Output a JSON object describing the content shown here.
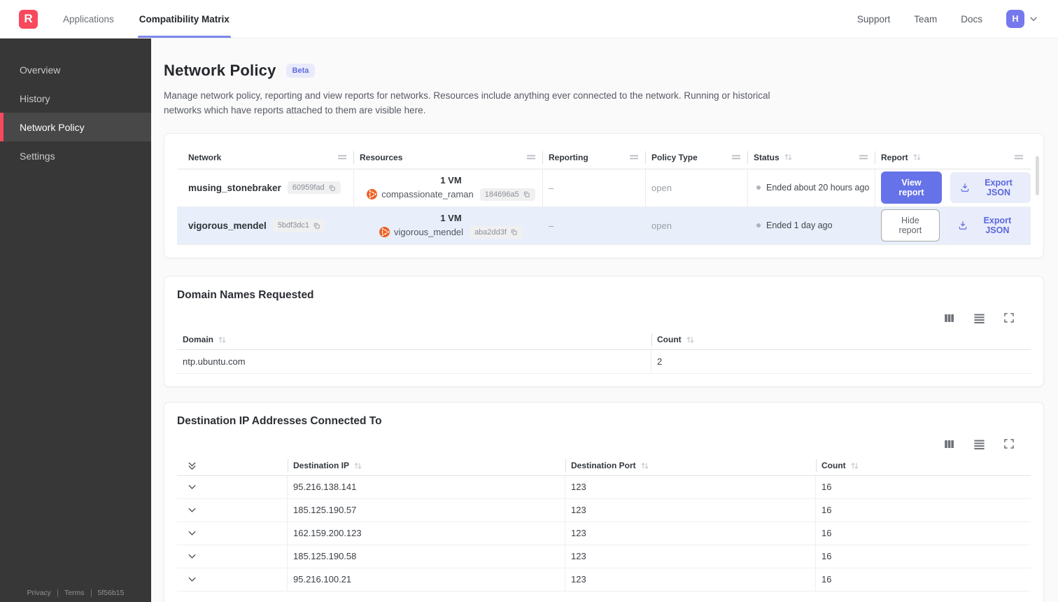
{
  "nav": {
    "logo_letter": "R",
    "tabs": [
      {
        "label": "Applications"
      },
      {
        "label": "Compatibility Matrix"
      }
    ],
    "links": [
      {
        "label": "Support"
      },
      {
        "label": "Team"
      },
      {
        "label": "Docs"
      }
    ],
    "avatar_letter": "H"
  },
  "sidebar": {
    "items": [
      {
        "label": "Overview"
      },
      {
        "label": "History"
      },
      {
        "label": "Network Policy"
      },
      {
        "label": "Settings"
      }
    ],
    "footer": {
      "privacy": "Privacy",
      "terms": "Terms",
      "version": "5f56b15"
    }
  },
  "page": {
    "title": "Network Policy",
    "beta_badge": "Beta",
    "description": "Manage network policy, reporting and view reports for networks. Resources include anything ever connected to the network. Running or historical networks which have reports attached to them are visible here."
  },
  "networks_table": {
    "columns": {
      "network": "Network",
      "resources": "Resources",
      "reporting": "Reporting",
      "policy_type": "Policy Type",
      "status": "Status",
      "report": "Report"
    },
    "rows": [
      {
        "name": "musing_stonebraker",
        "id": "60959fad",
        "vm_count": "1 VM",
        "resource_name": "compassionate_raman",
        "resource_id": "184696a5",
        "reporting": "–",
        "policy_type": "open",
        "status": "Ended about 20 hours ago",
        "report_button": "View report",
        "export_label": "Export JSON"
      },
      {
        "name": "vigorous_mendel",
        "id": "5bdf3dc1",
        "vm_count": "1 VM",
        "resource_name": "vigorous_mendel",
        "resource_id": "aba2dd3f",
        "reporting": "–",
        "policy_type": "open",
        "status": "Ended 1 day ago",
        "report_button": "Hide report",
        "export_label": "Export JSON"
      }
    ]
  },
  "domains_section": {
    "title": "Domain Names Requested",
    "columns": {
      "domain": "Domain",
      "count": "Count"
    },
    "rows": [
      {
        "domain": "ntp.ubuntu.com",
        "count": "2"
      }
    ]
  },
  "destinations_section": {
    "title": "Destination IP Addresses Connected To",
    "columns": {
      "ip": "Destination IP",
      "port": "Destination Port",
      "count": "Count"
    },
    "rows": [
      {
        "ip": "95.216.138.141",
        "port": "123",
        "count": "16"
      },
      {
        "ip": "185.125.190.57",
        "port": "123",
        "count": "16"
      },
      {
        "ip": "162.159.200.123",
        "port": "123",
        "count": "16"
      },
      {
        "ip": "185.125.190.58",
        "port": "123",
        "count": "16"
      },
      {
        "ip": "95.216.100.21",
        "port": "123",
        "count": "16"
      }
    ]
  },
  "icons": {
    "toolbar": [
      "view-columns-icon",
      "row-density-icon",
      "fullscreen-icon"
    ],
    "vm_platform": "ubuntu-icon"
  },
  "colors": {
    "accent_purple": "#6672e8",
    "brand_red": "#f8485e",
    "row_highlight": "#e8effa",
    "beta_bg": "#e9ebfc",
    "sidebar_bg": "#373737"
  }
}
